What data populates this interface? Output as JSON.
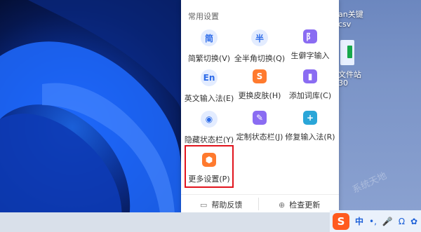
{
  "desktop": {
    "top_label": "an关键",
    "file_label": "csv",
    "file2_label_line1": "文件站",
    "file2_label_line2": "30"
  },
  "menu": {
    "section_title": "常用设置",
    "items": [
      {
        "label": "简繁切换(V)",
        "glyph": "简",
        "icon": "simplified-traditional-icon"
      },
      {
        "label": "全半角切换(Q)",
        "glyph": "半",
        "icon": "half-width-icon"
      },
      {
        "label": "生僻字输入",
        "glyph": "阝",
        "icon": "rare-char-icon"
      },
      {
        "label": "英文输入法(E)",
        "glyph": "En",
        "icon": "english-icon"
      },
      {
        "label": "更换皮肤(H)",
        "glyph": "S",
        "icon": "skin-icon"
      },
      {
        "label": "添加词库(C)",
        "glyph": "▮",
        "icon": "dictionary-icon"
      },
      {
        "label": "隐藏状态栏(Y)",
        "glyph": "◉",
        "icon": "eye-hidden-icon"
      },
      {
        "label": "定制状态栏(J)",
        "glyph": "✎",
        "icon": "customize-icon"
      },
      {
        "label": "修复输入法(R)",
        "glyph": "+",
        "icon": "repair-kit-icon"
      },
      {
        "label": "更多设置(P)",
        "glyph": "⬢",
        "icon": "settings-icon"
      }
    ],
    "footer": {
      "help_label": "帮助反馈",
      "update_label": "检查更新"
    }
  },
  "ime_bar": {
    "logo": "S",
    "mode": "中",
    "punct": "•,",
    "mic": "🎤",
    "headset": "Ω",
    "more": "✿"
  },
  "colors": {
    "highlight": "#e1141d",
    "sogou_orange": "#ff5a1f",
    "accent_blue": "#2d6be8"
  }
}
